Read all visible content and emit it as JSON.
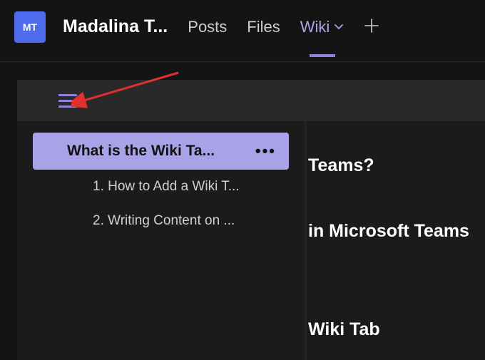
{
  "header": {
    "avatar_text": "MT",
    "team_name": "Madalina T...",
    "tabs": {
      "posts": "Posts",
      "files": "Files",
      "wiki": "Wiki"
    }
  },
  "sidebar": {
    "page_title": "What is the Wiki Ta...",
    "sections": [
      "1. How to Add a Wiki T...",
      "2. Writing Content on ..."
    ]
  },
  "content": {
    "h1_fragment": "Teams?",
    "h2_fragment": "in Microsoft Teams",
    "h3_fragment": "Wiki Tab"
  }
}
